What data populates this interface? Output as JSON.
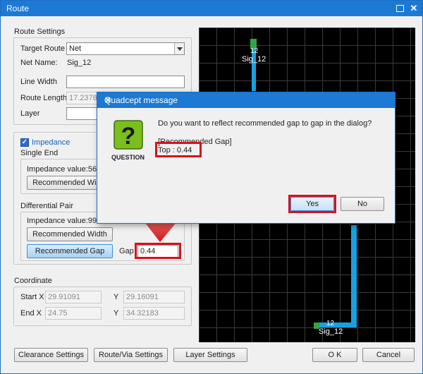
{
  "window": {
    "title": "Route"
  },
  "route_settings": {
    "heading": "Route Settings",
    "target_route_label": "Target Route",
    "target_route_value": "Net",
    "net_name_label": "Net Name:",
    "net_name_value": "Sig_12",
    "line_width_label": "Line Width",
    "line_width_value": "",
    "route_length_label": "Route Length",
    "route_length_value": "17.2378",
    "layer_label": "Layer",
    "layer_value": ""
  },
  "impedance": {
    "checkbox_label": "Impedance",
    "single_end_label": "Single End",
    "single_impedance": "Impedance value:56Ω",
    "single_rec_width": "Recommended Width",
    "diff_pair_label": "Differential Pair",
    "diff_impedance": "Impedance value:99Ω",
    "diff_rec_width": "Recommended Width",
    "rec_gap": "Recommended Gap",
    "gap_label": "Gap",
    "gap_value": "0.44"
  },
  "coordinate": {
    "heading": "Coordinate",
    "start_x_label": "Start X",
    "start_x": "29.91091",
    "start_y_label": "Y",
    "start_y": "29.16091",
    "end_x_label": "End X",
    "end_x": "24.75",
    "end_y_label": "Y",
    "end_y": "34.32183"
  },
  "footer": {
    "clearance": "Clearance Settings",
    "route_via": "Route/Via Settings",
    "layer": "Layer Settings",
    "ok": "O K",
    "cancel": "Cancel"
  },
  "canvas": {
    "top_net_num": "12",
    "top_net_name": "Sig_12",
    "bottom_net_num": "12",
    "bottom_net_name": "Sig_12"
  },
  "dialog": {
    "title": "Quadcept message",
    "icon_caption": "QUESTION",
    "question": "Do you want to reflect recommended gap to gap in the dialog?",
    "gap_heading": "[Recommended Gap]",
    "gap_line": "Top : 0.44",
    "yes": "Yes",
    "no": "No"
  },
  "colors": {
    "accent": "#1c79d4",
    "trace": "#1aa0e0",
    "highlight": "#d4141c",
    "icon_green": "#7bbf1e"
  }
}
